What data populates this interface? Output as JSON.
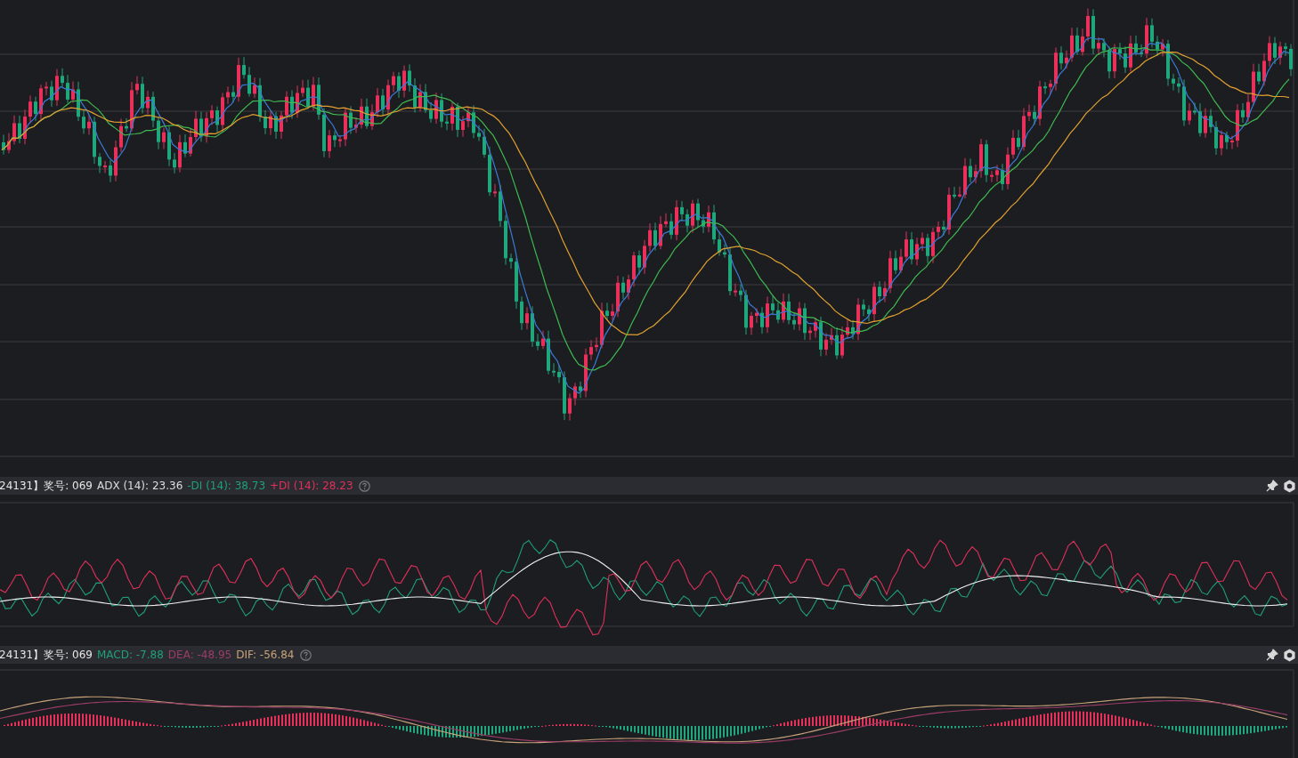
{
  "panels": [
    {
      "prefix": "24131】奖号: 069",
      "legend": [
        {
          "text": "ADX (14): 23.36",
          "color": "#dcdcdc"
        },
        {
          "text": "-DI (14): 38.73",
          "color": "#1f9f7a"
        },
        {
          "text": "+DI (14): 28.23",
          "color": "#e0305a"
        }
      ]
    },
    {
      "prefix": "24131】奖号: 069",
      "legend": [
        {
          "text": "MACD: -7.88",
          "color": "#1f9f7a"
        },
        {
          "text": "DEA: -48.95",
          "color": "#9a3d68"
        },
        {
          "text": "DIF: -56.84",
          "color": "#c8a27a"
        }
      ]
    }
  ]
}
